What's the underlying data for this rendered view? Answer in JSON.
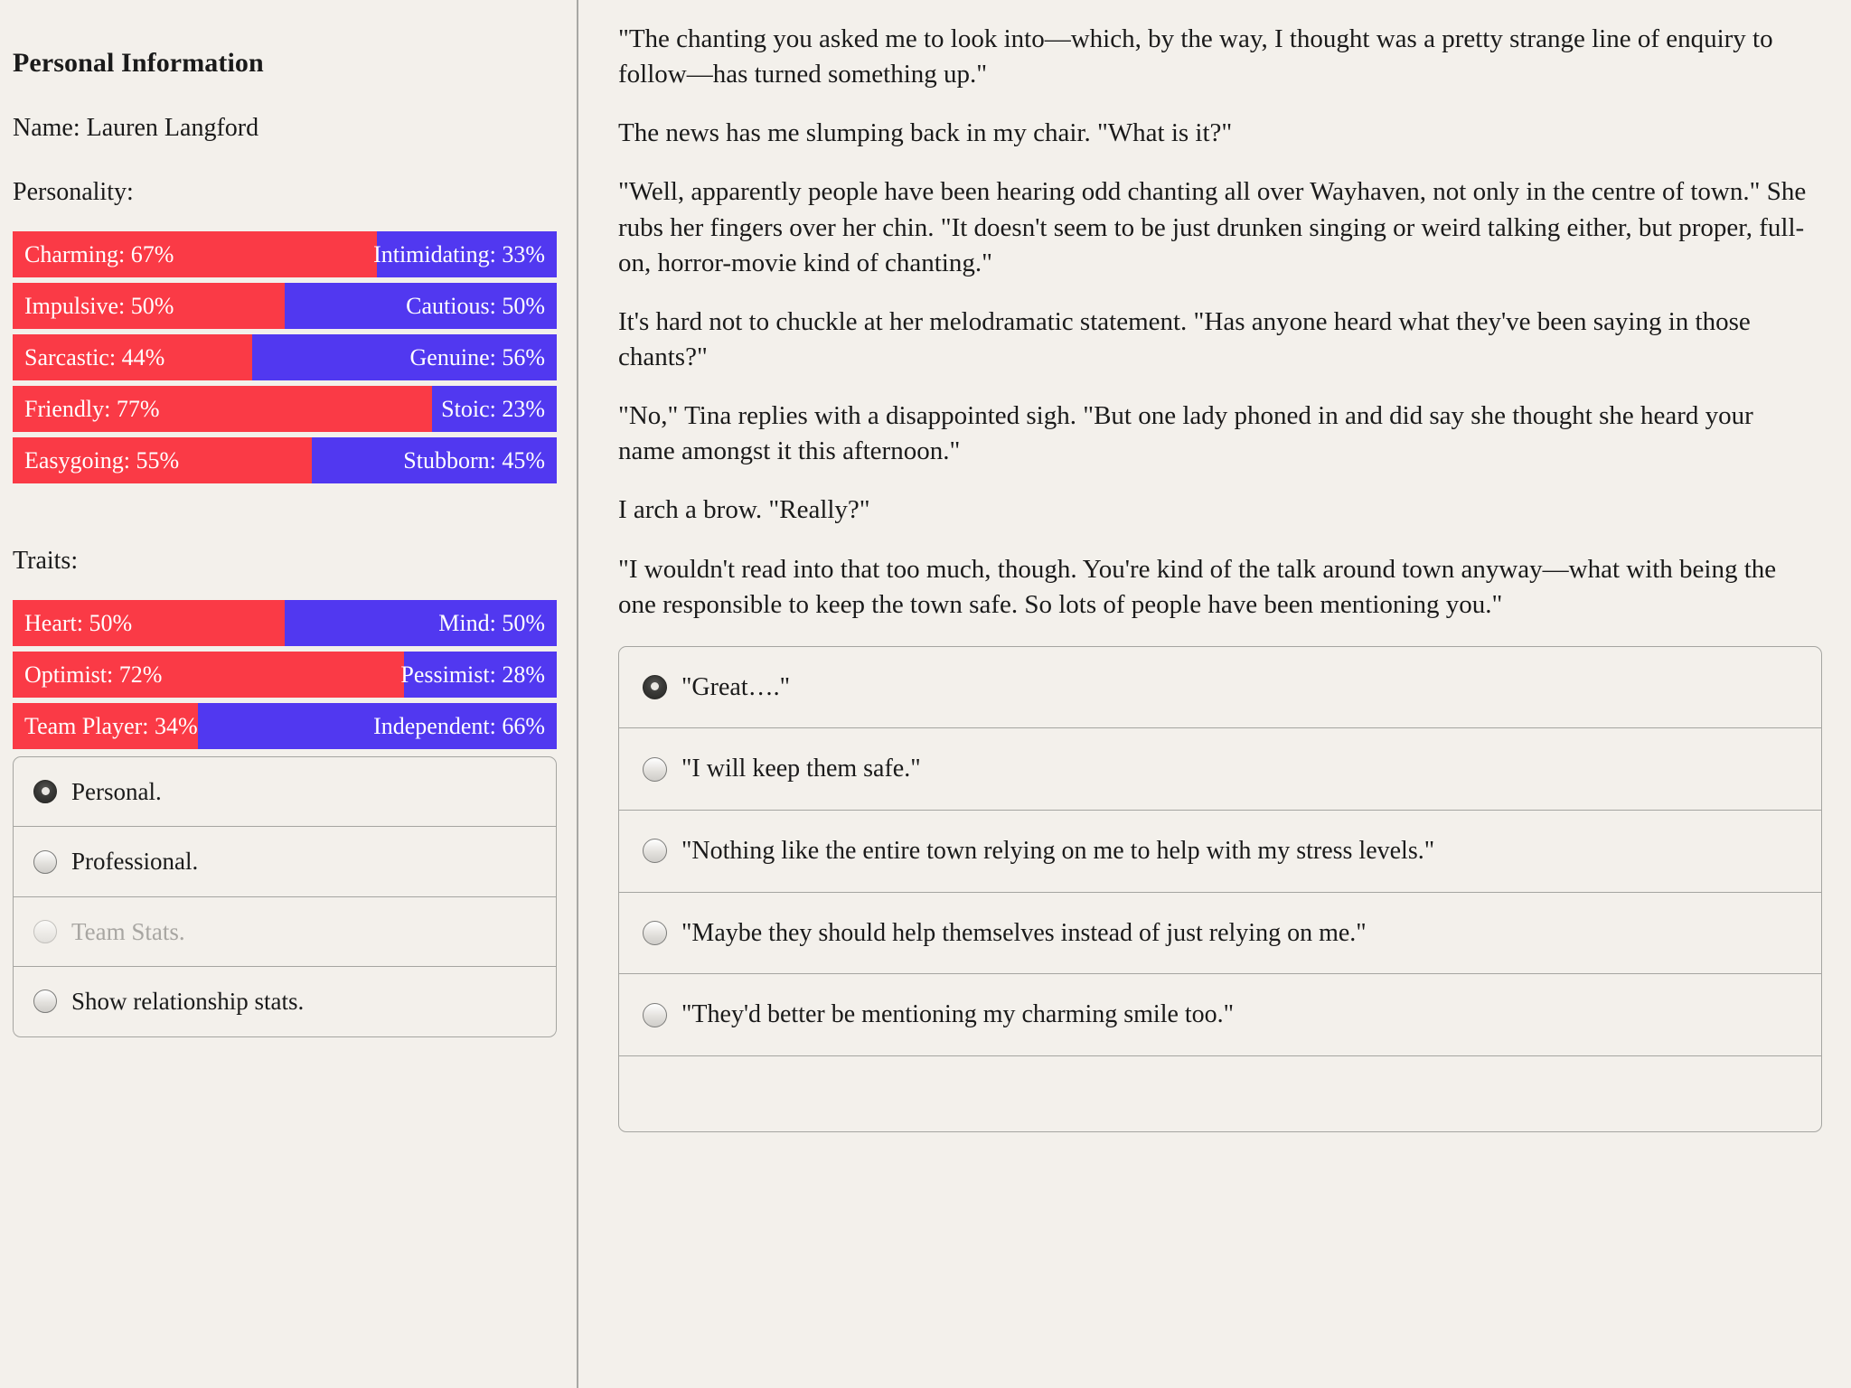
{
  "sidebar": {
    "title": "Personal Information",
    "name_line": "Name: Lauren Langford",
    "personality_label": "Personality:",
    "traits_label": "Traits:",
    "personality_bars": [
      {
        "left_label": "Charming: 67%",
        "right_label": "Intimidating: 33%",
        "left_value": 67,
        "right_value": 33
      },
      {
        "left_label": "Impulsive: 50%",
        "right_label": "Cautious: 50%",
        "left_value": 50,
        "right_value": 50
      },
      {
        "left_label": "Sarcastic: 44%",
        "right_label": "Genuine: 56%",
        "left_value": 44,
        "right_value": 56
      },
      {
        "left_label": "Friendly: 77%",
        "right_label": "Stoic: 23%",
        "left_value": 77,
        "right_value": 23
      },
      {
        "left_label": "Easygoing: 55%",
        "right_label": "Stubborn: 45%",
        "left_value": 55,
        "right_value": 45
      }
    ],
    "trait_bars": [
      {
        "left_label": "Heart: 50%",
        "right_label": "Mind: 50%",
        "left_value": 50,
        "right_value": 50
      },
      {
        "left_label": "Optimist: 72%",
        "right_label": "Pessimist: 28%",
        "left_value": 72,
        "right_value": 28
      },
      {
        "left_label": "Team Player: 34%",
        "right_label": "Independent: 66%",
        "left_value": 34,
        "right_value": 66
      }
    ],
    "options": [
      {
        "label": "Personal.",
        "selected": true,
        "disabled": false
      },
      {
        "label": "Professional.",
        "selected": false,
        "disabled": false
      },
      {
        "label": "Team Stats.",
        "selected": false,
        "disabled": true
      },
      {
        "label": "Show relationship stats.",
        "selected": false,
        "disabled": false
      }
    ],
    "colors": {
      "bar_left": "#fa3a46",
      "bar_right": "#5138f0",
      "bar_text": "#ffffff"
    }
  },
  "main": {
    "paragraphs": [
      "\"The chanting you asked me to look into—which, by the way, I thought was a pretty strange line of enquiry to follow—has turned something up.\"",
      "The news has me slumping back in my chair. \"What is it?\"",
      "\"Well, apparently people have been hearing odd chanting all over Wayhaven, not only in the centre of town.\" She rubs her fingers over her chin. \"It doesn't seem to be just drunken singing or weird talking either, but proper, full-on, horror-movie kind of chanting.\"",
      "It's hard not to chuckle at her melodramatic statement. \"Has anyone heard what they've been saying in those chants?\"",
      "\"No,\" Tina replies with a disappointed sigh. \"But one lady phoned in and did say she thought she heard your name amongst it this afternoon.\"",
      "I arch a brow. \"Really?\"",
      "\"I wouldn't read into that too much, though. You're kind of the talk around town anyway—what with being the one responsible to keep the town safe. So lots of people have been mentioning you.\""
    ],
    "choices": [
      {
        "label": "\"Great….\"",
        "selected": true
      },
      {
        "label": "\"I will keep them safe.\"",
        "selected": false
      },
      {
        "label": "\"Nothing like the entire town relying on me to help with my stress levels.\"",
        "selected": false
      },
      {
        "label": "\"Maybe they should help themselves instead of just relying on me.\"",
        "selected": false
      },
      {
        "label": "\"They'd better be mentioning my charming smile too.\"",
        "selected": false
      },
      {
        "label": "",
        "selected": false
      }
    ]
  }
}
